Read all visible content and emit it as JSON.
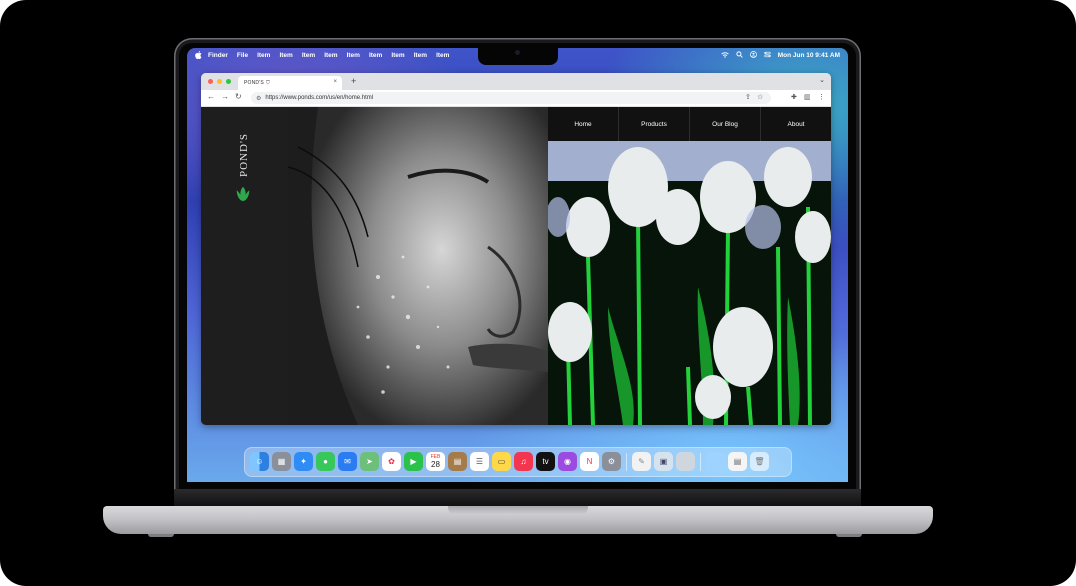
{
  "menubar": {
    "app_name": "Finder",
    "items": [
      "File",
      "Item",
      "Item",
      "Item",
      "Item",
      "Item",
      "Item",
      "Item",
      "Item",
      "Item"
    ],
    "clock": "Mon Jun 10  9:41 AM"
  },
  "browser": {
    "tab_title": "POND'S",
    "url": "https://www.ponds.com/us/en/home.html"
  },
  "site": {
    "brand": "POND'S",
    "nav": [
      "Home",
      "Products",
      "Our Blog",
      "About"
    ],
    "brand_color": "#2ea84a"
  },
  "dock": {
    "calendar_month": "FEB",
    "calendar_day": "28",
    "apps": [
      "finder-icon",
      "launchpad-icon",
      "safari-icon",
      "messages-icon",
      "mail-icon",
      "maps-icon",
      "photos-icon",
      "facetime-icon",
      "calendar-icon",
      "notes-brown-icon",
      "reminders-icon",
      "notes-icon",
      "music-icon",
      "tv-icon",
      "podcasts-icon",
      "news-icon",
      "settings-icon",
      "pages-icon",
      "preview-icon",
      "blank-app-icon",
      "folder-icon",
      "document-icon",
      "trash-icon"
    ]
  }
}
